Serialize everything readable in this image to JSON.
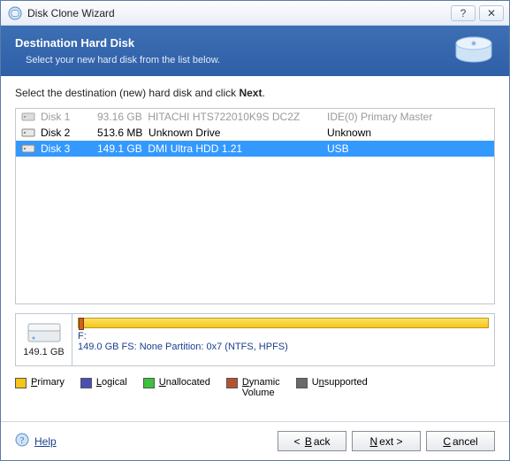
{
  "window": {
    "title": "Disk Clone Wizard"
  },
  "banner": {
    "heading": "Destination Hard Disk",
    "sub": "Select your new hard disk from the list below."
  },
  "instruction": {
    "pre": "Select the destination (new) hard disk and click ",
    "bold": "Next",
    "post": "."
  },
  "disks": [
    {
      "name": "Disk 1",
      "size": "93.16 GB",
      "model": "HITACHI HTS722010K9S DC2Z",
      "iface": "IDE(0) Primary Master",
      "state": "disabled"
    },
    {
      "name": "Disk 2",
      "size": "513.6 MB",
      "model": "Unknown Drive",
      "iface": "Unknown",
      "state": "normal"
    },
    {
      "name": "Disk 3",
      "size": "149.1 GB",
      "model": "DMI Ultra HDD 1.21",
      "iface": "USB",
      "state": "selected"
    }
  ],
  "detail": {
    "capacity": "149.1 GB",
    "line1": "F:",
    "line2": "149.0 GB  FS: None Partition: 0x7 (NTFS, HPFS)"
  },
  "legend": {
    "primary": {
      "label": "Primary",
      "key": "P",
      "color": "#f5c518"
    },
    "logical": {
      "label": "Logical",
      "key": "L",
      "color": "#4a4fb5"
    },
    "unalloc": {
      "label": "Unallocated",
      "key": "U",
      "color": "#3cc23c"
    },
    "dynamic": {
      "label": "Dynamic",
      "key": "D",
      "color": "#b5522e",
      "sub": "Volume"
    },
    "unsupp": {
      "label": "Unsupported",
      "key": "n",
      "color": "#6a6a6a",
      "prefix": "U"
    }
  },
  "footer": {
    "help": "Help",
    "back": "Back",
    "next": "Next",
    "cancel": "Cancel"
  }
}
